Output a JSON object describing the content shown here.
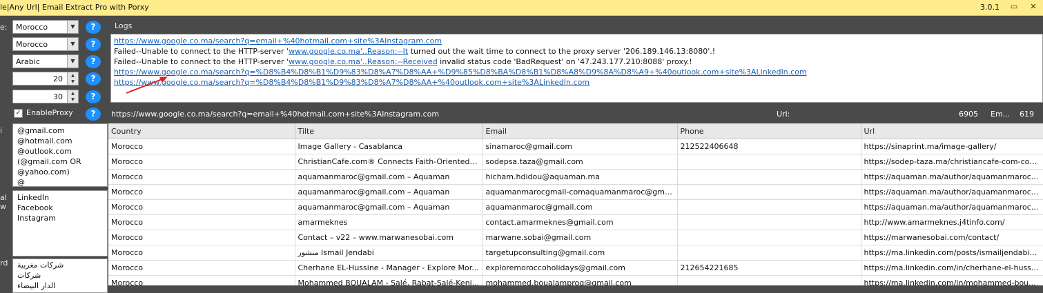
{
  "window": {
    "title": "le|Any Url| Email Extract Pro with Porxy",
    "version": "3.0.1",
    "controls": [
      "▭",
      "✕"
    ]
  },
  "left_panel": {
    "labels": {
      "country": "e:",
      "sponsor": "i",
      "source": "al",
      "source2": "w",
      "keyword": "rd"
    },
    "country_select": "Morocco",
    "country_select2": "Morocco",
    "language_select": "Arabic",
    "spin1": "20",
    "spin2": "30",
    "help_label": "?",
    "enable_proxy_label": "EnableProxy",
    "domains": [
      "@gmail.com",
      "@hotmail.com",
      "@outlook.com",
      "(@gmail.com OR",
      "@yahoo.com)",
      "@"
    ],
    "sites": [
      "LinkedIn",
      "Facebook",
      "Instagram"
    ],
    "keywords": [
      "شركات مغربية",
      "شركات",
      "الدار البيضاء"
    ]
  },
  "logs": {
    "caption": "Logs",
    "line1_url": "https://www.google.co.ma/search?q=email+%40hotmail.com+site%3AInstagram.com",
    "line2_pre": "Failed--Unable to connect to the HTTP-server '",
    "line2_link": "www.google.co.ma'..Reason:--It",
    "line2_post": " turned out the wait time to connect to the proxy server '206.189.146.13:8080'.!",
    "line3_pre": "Failed--Unable to connect to the HTTP-server '",
    "line3_link": "www.google.co.ma'..Reason:--Received",
    "line3_post": " invalid status code 'BadRequest' on '47.243.177.210:8088' proxy.!",
    "line4_url": "https://www.google.co.ma/search?q=%D8%B4%D8%B1%D9%83%D8%A7%D8%AA+%D9%85%D8%BA%D8%B1%D8%A8%D9%8A%D8%A9+%40outlook.com+site%3ALinkedIn.com",
    "line5_url": "https://www.google.co.ma/search?q=%D8%B4%D8%B1%D9%83%D8%A7%D8%AA+%40outlook.com+site%3ALinkedIn.com"
  },
  "status": {
    "current_url": "https://www.google.co.ma/search?q=email+%40hotmail.com+site%3AInstagram.com",
    "url_label": "Url:",
    "url_count": "6905",
    "em_label": "Em...",
    "em_count": "619"
  },
  "grid": {
    "headers": [
      "Country",
      "Tilte",
      "Email",
      "Phone",
      "Url"
    ],
    "rows": [
      [
        "Morocco",
        "Image Gallery - Casablanca",
        "sinamaroc@gmail.com",
        "212522406648",
        "https://sinaprint.ma/image-gallery/"
      ],
      [
        "Morocco",
        "ChristianCafe.com® Connects Faith-Oriented S...",
        "sodepsa.taza@gmail.com",
        "",
        "https://sodep-taza.ma/christiancafe-com-con..."
      ],
      [
        "Morocco",
        "aquamanmaroc@gmail.com – Aquaman",
        "hicham.hdidou@aquaman.ma",
        "",
        "https://aquaman.ma/author/aquamanmaroc..."
      ],
      [
        "Morocco",
        "aquamanmaroc@gmail.com – Aquaman",
        "aquamanmarocgmail-comaquamanmaroc@gma...",
        "",
        "https://aquaman.ma/author/aquamanmaroc..."
      ],
      [
        "Morocco",
        "aquamanmaroc@gmail.com – Aquaman",
        "aquamanmaroc@gmail.com",
        "",
        "https://aquaman.ma/author/aquamanmaroc..."
      ],
      [
        "Morocco",
        "amarmeknes",
        "contact.amarmeknes@gmail.com",
        "",
        "http://www.amarmeknes.j4tinfo.com/"
      ],
      [
        "Morocco",
        "Contact – v22 – www.marwanesobai.com",
        "marwane.sobai@gmail.com",
        "",
        "https://marwanesobai.com/contact/"
      ],
      [
        "Morocco",
        "منشور Ismail Jendabi",
        "targetupconsulting@gmail.com",
        "",
        "https://ma.linkedin.com/posts/ismailjendabi_..."
      ],
      [
        "Morocco",
        "Cherhane EL-Hussine - Manager - Explore Mor...",
        "exploremoroccoholidays@gmail.com",
        "212654221685",
        "https://ma.linkedin.com/in/cherhane-el-hussi..."
      ],
      [
        "Morocco",
        "Mohammed BOUALAM - Salé, Rabat-Salé-Keni...",
        "mohammed.boualamprog@gmail.com",
        "",
        "https://ma.linkedin.com/in/mohammed-bou..."
      ]
    ]
  }
}
